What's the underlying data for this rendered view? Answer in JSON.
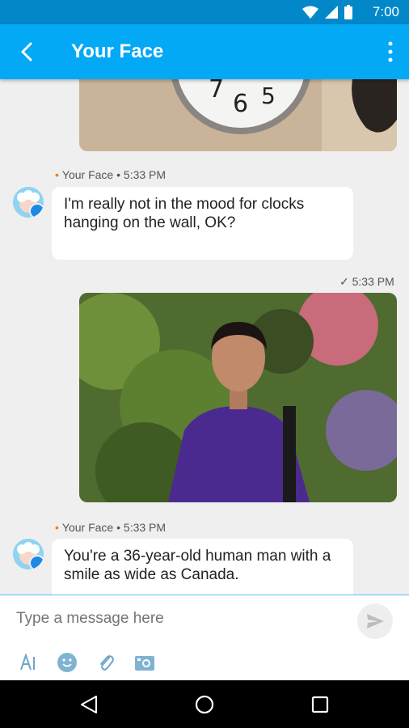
{
  "status_bar": {
    "time": "7:00"
  },
  "app_bar": {
    "title": "Your Face"
  },
  "messages": [
    {
      "sender": "Your Face",
      "time": "5:33 PM",
      "text": "I'm really not in the mood for clocks hanging on the wall, OK?"
    },
    {
      "sent_time": "5:33 PM"
    },
    {
      "sender": "Your Face",
      "time": "5:33 PM",
      "text": "You're a 36-year-old human man with a smile as wide as Canada."
    }
  ],
  "composer": {
    "placeholder": "Type a message here"
  },
  "colors": {
    "status_bar": "#0288c9",
    "app_bar": "#03a9f4",
    "accent_dot": "#f57c00",
    "background": "#efefef"
  }
}
